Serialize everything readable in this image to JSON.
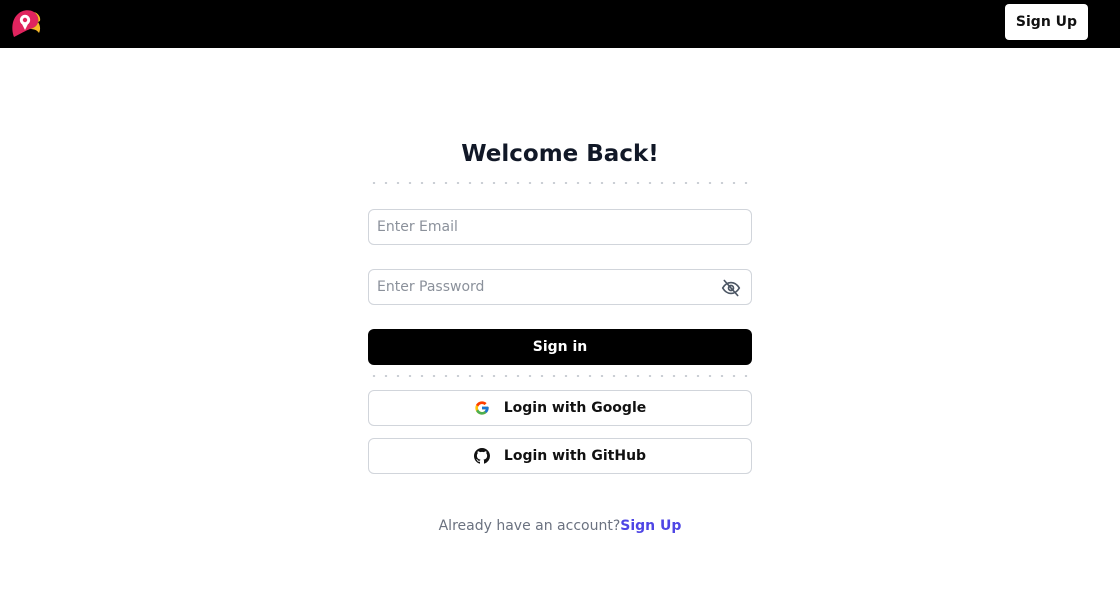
{
  "header": {
    "logo_icon": "parrot-logo-icon",
    "signup_label": "Sign Up"
  },
  "form": {
    "title": "Welcome Back!",
    "email_placeholder": "Enter Email",
    "email_value": "",
    "password_placeholder": "Enter Password",
    "password_value": "",
    "password_toggle_icon": "eye-off-icon",
    "signin_label": "Sign in"
  },
  "oauth": {
    "google_label": "Login with Google",
    "google_icon": "google-icon",
    "github_label": "Login with GitHub",
    "github_icon": "github-icon"
  },
  "footer": {
    "prompt_text": "Already have an account?",
    "link_text": "Sign Up"
  },
  "colors": {
    "header_bg": "#000000",
    "primary_button_bg": "#000000",
    "link": "#4f46e5",
    "border": "#d1d5db"
  }
}
